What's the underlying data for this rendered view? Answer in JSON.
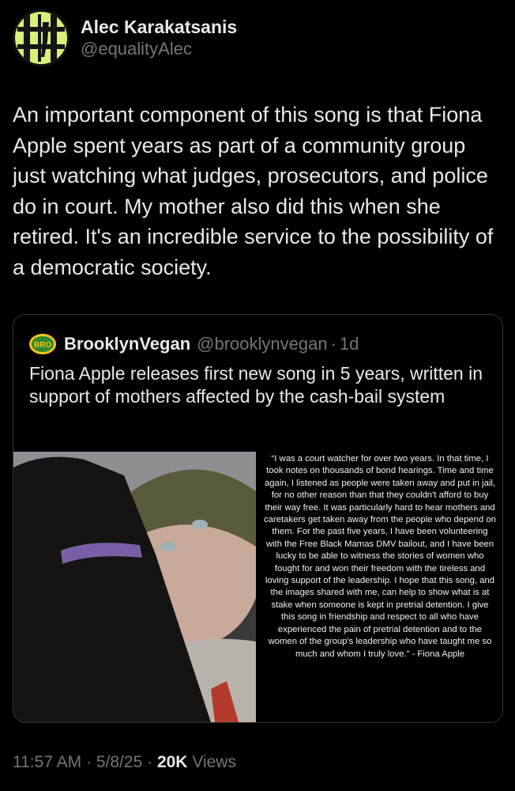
{
  "author": {
    "display_name": "Alec Karakatsanis",
    "handle": "@equalityAlec"
  },
  "tweet": {
    "text": "An important component of this song is that Fiona Apple spent years as part of a community group just watching what judges, prosecutors, and police do in court. My mother also did this when she retired. It's an incredible service to the possibility of a democratic society."
  },
  "quote": {
    "logo_text": "BRO",
    "name": "BrooklynVegan",
    "handle": "@brooklynvegan",
    "separator": "·",
    "time": "1d",
    "text": "Fiona Apple releases first new song in 5 years, written in support of mothers affected by the cash-bail system",
    "statement": "“I was a court watcher for over two years. In that time, I took notes on thousands of bond hearings. Time and time again, I listened as people were taken away and put in jail, for no other reason than that they couldn't afford to buy their way free. It was particularly hard to hear mothers and caretakers get taken away from the people who depend on them. For the past five years, I have been volunteering with the Free Black Mamas DMV bailout, and I have been lucky to be able to witness the stories of women who fought for and won their freedom with the tireless and loving support of the leadership. I hope that this song, and the images shared with me, can help to show what is at stake when someone is kept in pretrial detention. I give this song in friendship and respect to all who have experienced the pain of pretrial detention and to the women of the group's leadership who have taught me so much and whom I truly love.” - Fiona Apple"
  },
  "meta": {
    "time": "11:57 AM",
    "sep1": "·",
    "date": "5/8/25",
    "sep2": "·",
    "views_count": "20K",
    "views_label": "Views"
  },
  "colors": {
    "background": "#000000",
    "text": "#e7e9ea",
    "secondary": "#71767b",
    "border": "#2f3336",
    "avatar_accent": "#d6f07a",
    "logo_bg": "#f3c01c"
  }
}
